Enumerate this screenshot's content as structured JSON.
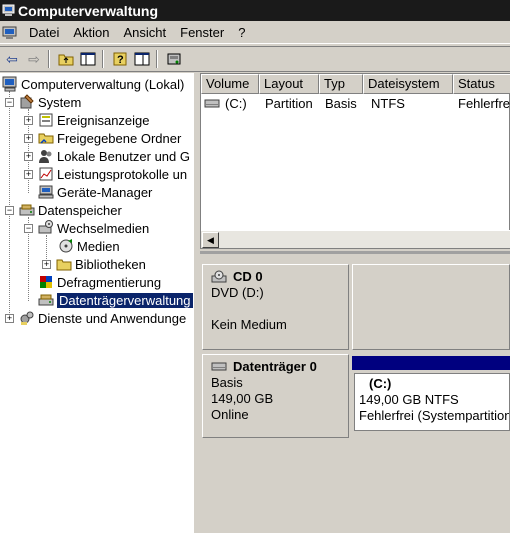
{
  "window": {
    "title": "Computerverwaltung"
  },
  "menu": {
    "items": [
      "Datei",
      "Aktion",
      "Ansicht",
      "Fenster",
      "?"
    ]
  },
  "tree": {
    "root": "Computerverwaltung (Lokal)",
    "system": "System",
    "ereignisanzeige": "Ereignisanzeige",
    "freigegebene": "Freigegebene Ordner",
    "benutzer": "Lokale Benutzer und G",
    "leistung": "Leistungsprotokolle un",
    "geraete": "Geräte-Manager",
    "datenspeicher": "Datenspeicher",
    "wechselmedien": "Wechselmedien",
    "medien": "Medien",
    "bibliotheken": "Bibliotheken",
    "defrag": "Defragmentierung",
    "datentraeger": "Datenträgerverwaltung",
    "dienste": "Dienste und Anwendunge"
  },
  "volume_table": {
    "columns": [
      "Volume",
      "Layout",
      "Typ",
      "Dateisystem",
      "Status"
    ],
    "rows": [
      {
        "volume": "(C:)",
        "layout": "Partition",
        "typ": "Basis",
        "dateisystem": "NTFS",
        "status": "Fehlerfrei"
      }
    ]
  },
  "disks": {
    "cd": {
      "name": "CD 0",
      "type": "DVD (D:)",
      "state": "Kein Medium"
    },
    "disk0": {
      "name": "Datenträger 0",
      "type": "Basis",
      "size": "149,00 GB",
      "state": "Online",
      "volume": {
        "label": "(C:)",
        "size": "149,00 GB NTFS",
        "status": "Fehlerfrei (Systempartition"
      }
    }
  },
  "colors": {
    "selection": "#0a246a",
    "volume_bar": "#00007f",
    "titlebar": "#1a1a1a"
  }
}
